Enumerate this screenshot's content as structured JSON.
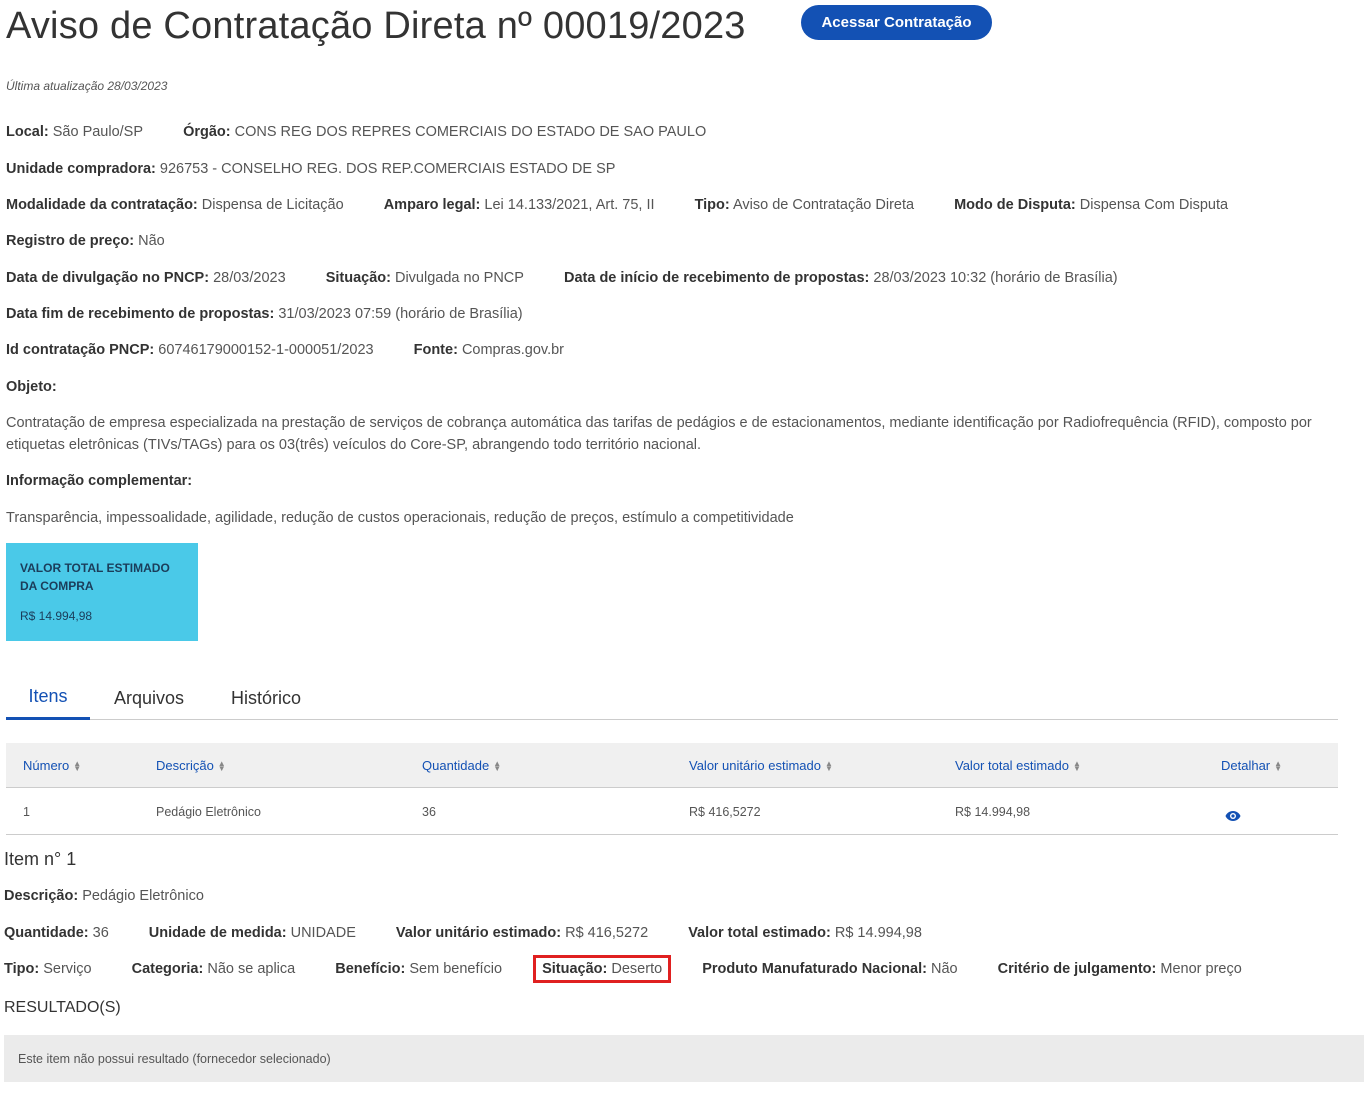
{
  "header": {
    "title": "Aviso de Contratação Direta nº 00019/2023",
    "access_button": "Acessar Contratação",
    "updated": "Última atualização 28/03/2023"
  },
  "details": {
    "local_label": "Local:",
    "local_value": "São Paulo/SP",
    "orgao_label": "Órgão:",
    "orgao_value": "CONS REG DOS REPRES COMERCIAIS DO ESTADO DE SAO PAULO",
    "unidade_label": "Unidade compradora:",
    "unidade_value": "926753 - CONSELHO REG. DOS REP.COMERCIAIS ESTADO DE SP",
    "modalidade_label": "Modalidade da contratação:",
    "modalidade_value": "Dispensa de Licitação",
    "amparo_label": "Amparo legal:",
    "amparo_value": "Lei 14.133/2021, Art. 75, II",
    "tipo_label": "Tipo:",
    "tipo_value": "Aviso de Contratação Direta",
    "modo_label": "Modo de Disputa:",
    "modo_value": "Dispensa Com Disputa",
    "registro_label": "Registro de preço:",
    "registro_value": "Não",
    "divulgacao_label": "Data de divulgação no PNCP:",
    "divulgacao_value": "28/03/2023",
    "situacao_label": "Situação:",
    "situacao_value": "Divulgada no PNCP",
    "inicio_label": "Data de início de recebimento de propostas:",
    "inicio_value": "28/03/2023 10:32 (horário de Brasília)",
    "fim_label": "Data fim de recebimento de propostas:",
    "fim_value": "31/03/2023 07:59 (horário de Brasília)",
    "id_label": "Id contratação PNCP:",
    "id_value": "60746179000152-1-000051/2023",
    "fonte_label": "Fonte:",
    "fonte_value": "Compras.gov.br",
    "objeto_label": "Objeto:",
    "objeto_text": "Contratação de empresa especializada na prestação de serviços de cobrança automática das tarifas de pedágios e de estacionamentos, mediante identificação por Radiofrequência (RFID), composto por etiquetas eletrônicas (TIVs/TAGs) para os 03(três) veículos do Core-SP, abrangendo todo território nacional.",
    "info_label": "Informação complementar:",
    "info_text": "Transparência, impessoalidade, agilidade, redução de custos operacionais, redução de preços, estímulo a competitividade"
  },
  "value_card": {
    "label": "VALOR TOTAL ESTIMADO DA COMPRA",
    "amount": "R$ 14.994,98"
  },
  "tabs": [
    {
      "label": "Itens"
    },
    {
      "label": "Arquivos"
    },
    {
      "label": "Histórico"
    }
  ],
  "table": {
    "headers": [
      "Número",
      "Descrição",
      "Quantidade",
      "Valor unitário estimado",
      "Valor total estimado",
      "Detalhar"
    ],
    "rows": [
      {
        "numero": "1",
        "descricao": "Pedágio Eletrônico",
        "quantidade": "36",
        "valor_unitario": "R$ 416,5272",
        "valor_total": "R$ 14.994,98",
        "detail_icon": "eye-icon"
      }
    ]
  },
  "item": {
    "title": "Item n° 1",
    "descricao_label": "Descrição:",
    "descricao_value": "Pedágio Eletrônico",
    "quantidade_label": "Quantidade:",
    "quantidade_value": "36",
    "unidade_label": "Unidade de medida:",
    "unidade_value": "UNIDADE",
    "unitario_label": "Valor unitário estimado:",
    "unitario_value": "R$ 416,5272",
    "total_label": "Valor total estimado:",
    "total_value": "R$ 14.994,98",
    "tipo_label": "Tipo:",
    "tipo_value": "Serviço",
    "categoria_label": "Categoria:",
    "categoria_value": "Não se aplica",
    "beneficio_label": "Benefício:",
    "beneficio_value": "Sem benefício",
    "situacao_label": "Situação:",
    "situacao_value": "Deserto",
    "produto_label": "Produto Manufaturado Nacional:",
    "produto_value": "Não",
    "criterio_label": "Critério de julgamento:",
    "criterio_value": "Menor preço"
  },
  "results": {
    "title": "RESULTADO(S)",
    "empty": "Este item não possui resultado (fornecedor selecionado)"
  },
  "colors": {
    "primary": "#1351b4",
    "card": "#4ac9e8",
    "highlight": "#e02020"
  }
}
